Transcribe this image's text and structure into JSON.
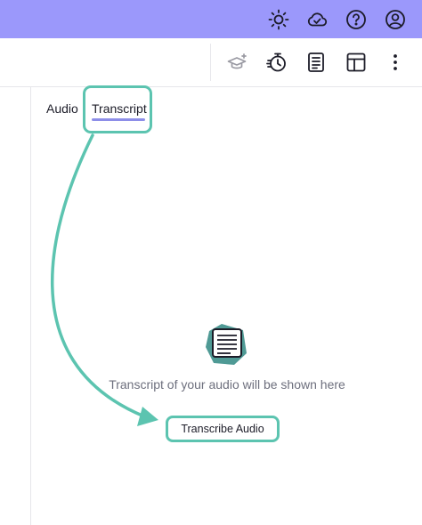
{
  "topbar": {
    "color": "#9b98fb",
    "icons": [
      "sun-icon",
      "cloud-check-icon",
      "help-circle-icon",
      "user-account-icon"
    ]
  },
  "toolbar": {
    "icons": [
      "graduation-cap-icon",
      "timer-icon",
      "document-icon",
      "layout-icon",
      "more-vertical-icon"
    ]
  },
  "tabs": [
    {
      "label": "Audio",
      "active": false
    },
    {
      "label": "Transcript",
      "active": true
    }
  ],
  "empty_state": {
    "icon": "document-icon",
    "message": "Transcript of your audio will be shown here",
    "button_label": "Transcribe Audio"
  },
  "colors": {
    "accent_teal": "#5cc4b0",
    "tab_underline": "#8d8ee8",
    "text": "#1c1c28",
    "muted_text": "#6d6f7d"
  }
}
